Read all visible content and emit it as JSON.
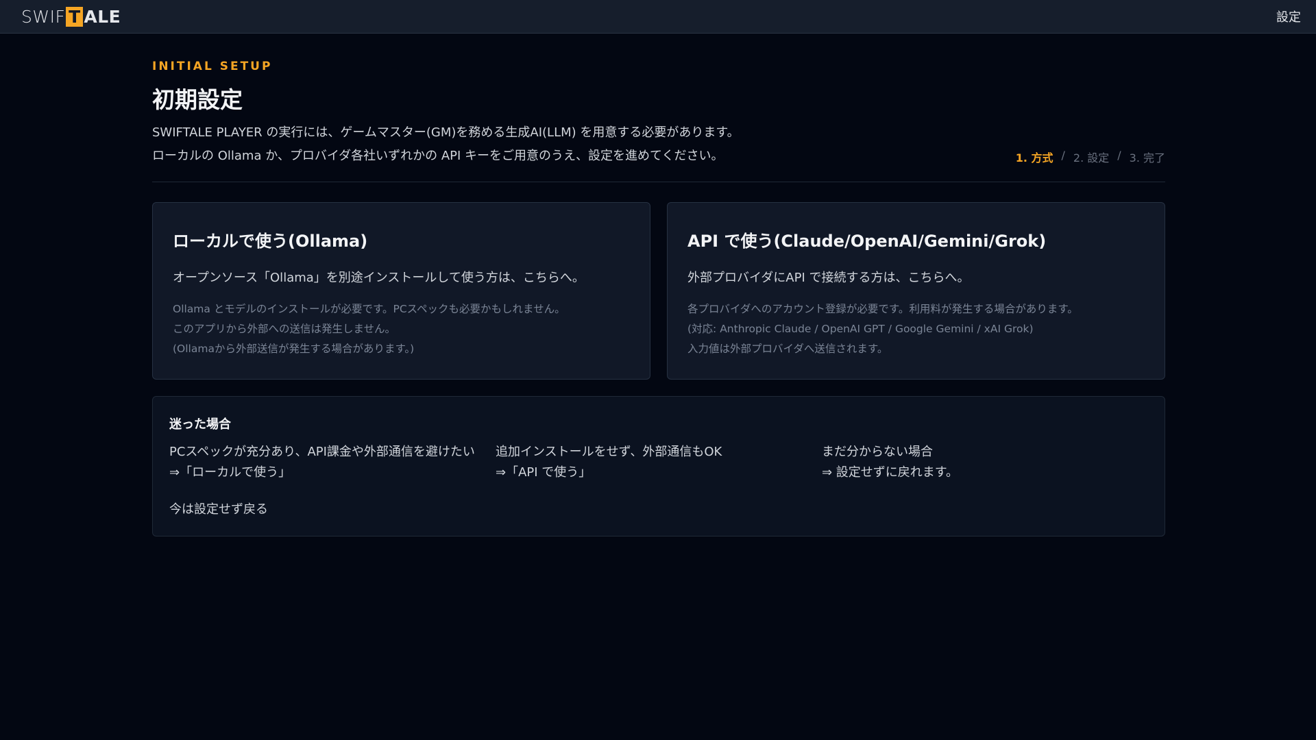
{
  "app": {
    "logo_prefix": "SWIF",
    "logo_box": "T",
    "logo_suffix": "ALE",
    "settings_label": "設定"
  },
  "setup": {
    "eyebrow": "INITIAL SETUP",
    "title": "初期設定",
    "desc_line1": "SWIFTALE PLAYER の実行には、ゲームマスター(GM)を務める生成AI(LLM) を用意する必要があります。",
    "desc_line2": "ローカルの Ollama か、プロバイダ各社いずれかの API キーをご用意のうえ、設定を進めてください。",
    "steps": [
      "1. 方式",
      "/",
      "2. 設定",
      "/",
      "3. 完了"
    ]
  },
  "cards": {
    "local": {
      "title": "ローカルで使う(Ollama)",
      "lead": "オープンソース「Ollama」を別途インストールして使う方は、こちらへ。",
      "notes": [
        "Ollama とモデルのインストールが必要です。PCスペックも必要かもしれません。",
        "このアプリから外部への送信は発生しません。",
        "(Ollamaから外部送信が発生する場合があります。)"
      ]
    },
    "api": {
      "title": "API で使う(Claude/OpenAI/Gemini/Grok)",
      "lead": "外部プロバイダにAPI で接続する方は、こちらへ。",
      "notes": [
        "各プロバイダへのアカウント登録が必要です。利用料が発生する場合があります。",
        "(対応: Anthropic Claude / OpenAI GPT / Google Gemini / xAI Grok)",
        "入力値は外部プロバイダへ送信されます。"
      ]
    }
  },
  "help": {
    "title": "迷った場合",
    "cols": [
      {
        "line1": "PCスペックが充分あり、API課金や外部通信を避けたい",
        "line2": "⇒「ローカルで使う」"
      },
      {
        "line1": "追加インストールをせず、外部通信もOK",
        "line2": "⇒「API で使う」"
      },
      {
        "line1": "まだ分からない場合",
        "line2": "⇒ 設定せずに戻れます。"
      }
    ],
    "back_label": "今は設定せず戻る"
  },
  "colors": {
    "accent": "#f5a524",
    "background": "#030712",
    "card": "#111827"
  }
}
